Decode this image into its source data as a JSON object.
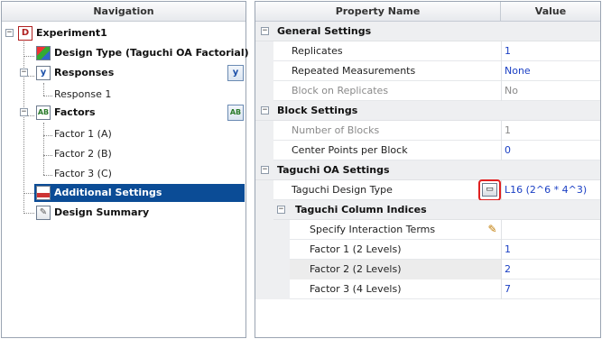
{
  "navigation": {
    "header": "Navigation",
    "root": {
      "label": "Experiment1",
      "expander": "−",
      "icon": "D"
    },
    "items": [
      {
        "label": "Design Type (Taguchi OA Factorial)",
        "icon": "grid"
      },
      {
        "label": "Responses",
        "icon": "y",
        "expander": "−",
        "side_button": "y",
        "children": [
          "Response 1"
        ]
      },
      {
        "label": "Factors",
        "icon": "AB",
        "expander": "−",
        "side_button": "AB",
        "children": [
          "Factor 1 (A)",
          "Factor 2 (B)",
          "Factor 3 (C)"
        ]
      },
      {
        "label": "Additional Settings",
        "icon": "settings",
        "selected": true
      },
      {
        "label": "Design Summary",
        "icon": "summary"
      }
    ]
  },
  "property_grid": {
    "header_name": "Property Name",
    "header_value": "Value",
    "general": {
      "title": "General Settings",
      "expander": "−",
      "replicates": {
        "name": "Replicates",
        "value": "1"
      },
      "repeated": {
        "name": "Repeated Measurements",
        "value": "None"
      },
      "block_on_rep": {
        "name": "Block on Replicates",
        "value": "No"
      }
    },
    "block": {
      "title": "Block Settings",
      "expander": "−",
      "num_blocks": {
        "name": "Number of Blocks",
        "value": "1"
      },
      "center_points": {
        "name": "Center Points per Block",
        "value": "0"
      }
    },
    "taguchi": {
      "title": "Taguchi OA Settings",
      "expander": "−",
      "design_type": {
        "name": "Taguchi Design Type",
        "value": "L16 (2^6 * 4^3)"
      },
      "column_indices": {
        "title": "Taguchi Column Indices",
        "expander": "−",
        "interaction": {
          "name": "Specify Interaction Terms"
        },
        "f1": {
          "name": "Factor 1 (2 Levels)",
          "value": "1"
        },
        "f2": {
          "name": "Factor 2 (2 Levels)",
          "value": "2"
        },
        "f3": {
          "name": "Factor 3 (4 Levels)",
          "value": "7"
        }
      }
    }
  },
  "colors": {
    "selection": "#0b4c96",
    "value_text": "#1a3fc4",
    "highlight_box": "#e02020"
  }
}
